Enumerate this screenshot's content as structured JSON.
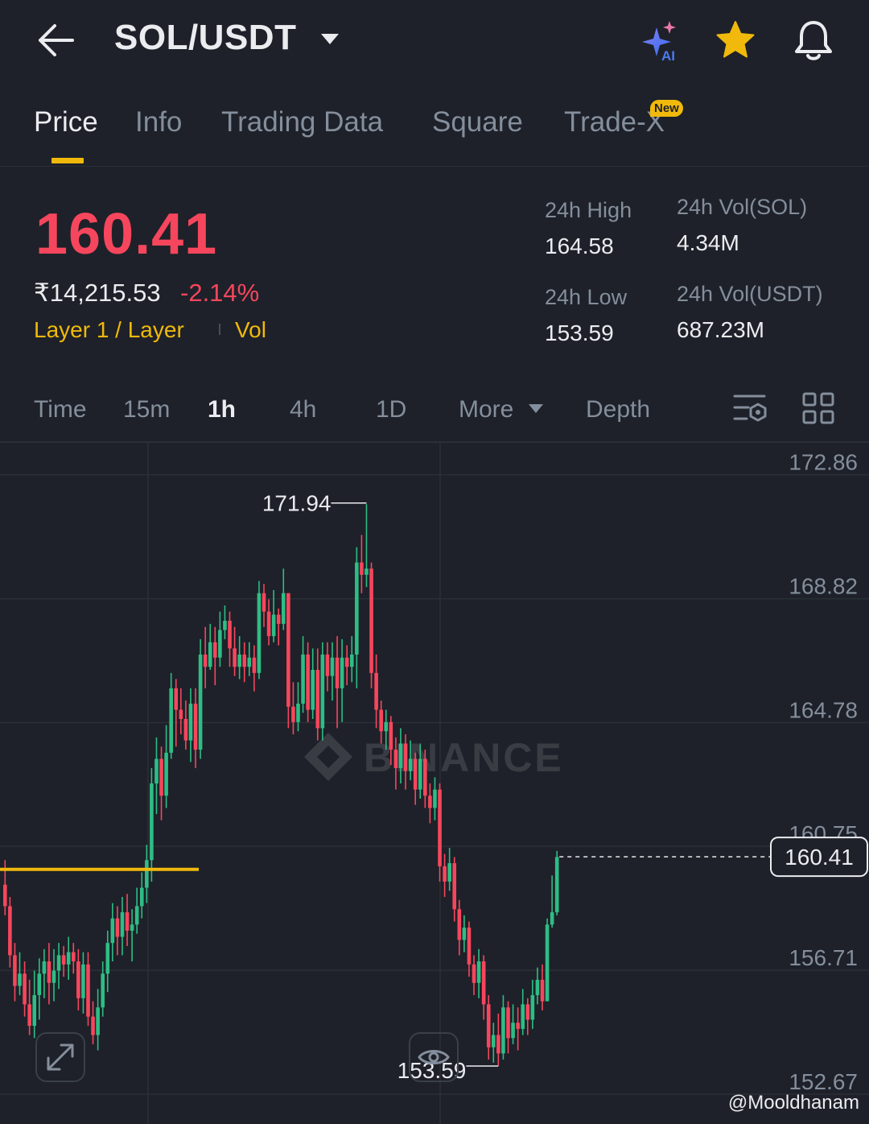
{
  "header": {
    "pair": "SOL/USDT",
    "icons": [
      "back-arrow-icon",
      "caret-down-icon",
      "ai-sparkle-icon",
      "star-icon",
      "bell-icon"
    ],
    "ai_label": "AI"
  },
  "tabs": [
    {
      "label": "Price",
      "active": true
    },
    {
      "label": "Info"
    },
    {
      "label": "Trading Data"
    },
    {
      "label": "Square"
    },
    {
      "label": "Trade-X",
      "badge": "New"
    }
  ],
  "price": {
    "last": "160.41",
    "fiat": "₹14,215.53",
    "change": "-2.14%",
    "tag1": "Layer 1 / Layer",
    "tag2": "Vol"
  },
  "stats": {
    "high_label": "24h High",
    "high": "164.58",
    "low_label": "24h Low",
    "low": "153.59",
    "vol_sol_label": "24h Vol(SOL)",
    "vol_sol": "4.34M",
    "vol_usdt_label": "24h Vol(USDT)",
    "vol_usdt": "687.23M"
  },
  "intervals": [
    {
      "label": "Time"
    },
    {
      "label": "15m"
    },
    {
      "label": "1h",
      "active": true
    },
    {
      "label": "4h"
    },
    {
      "label": "1D"
    },
    {
      "label": "More"
    },
    {
      "label": "Depth"
    }
  ],
  "colors": {
    "up": "#2ebd85",
    "down": "#f6465d",
    "accent": "#f0b90b",
    "bg": "#1e2129",
    "grid": "#2b2f36"
  },
  "chart_data": {
    "type": "candlestick",
    "y_ticks": [
      172.86,
      168.82,
      164.78,
      160.75,
      156.71,
      152.67
    ],
    "ylim": [
      151.7,
      173.9
    ],
    "grid": true,
    "last_price": 160.41,
    "high_marker": 171.94,
    "low_marker": 153.59,
    "reference_line": 160.0,
    "watermark": "BINANCE",
    "candles": [
      [
        159.5,
        158.8,
        160.3,
        158.5
      ],
      [
        158.8,
        157.2,
        159.1,
        156.8
      ],
      [
        157.2,
        156.2,
        157.6,
        155.7
      ],
      [
        156.2,
        156.6,
        157.3,
        155.9
      ],
      [
        156.6,
        155.6,
        157.0,
        155.2
      ],
      [
        155.6,
        154.9,
        156.4,
        154.6
      ],
      [
        154.9,
        155.9,
        156.7,
        154.5
      ],
      [
        155.9,
        156.6,
        157.1,
        155.1
      ],
      [
        156.6,
        157.0,
        157.4,
        155.8
      ],
      [
        157.0,
        156.3,
        157.6,
        155.6
      ],
      [
        156.3,
        156.7,
        157.4,
        155.7
      ],
      [
        156.7,
        157.2,
        157.6,
        156.1
      ],
      [
        157.2,
        156.9,
        157.5,
        156.5
      ],
      [
        156.9,
        157.3,
        157.8,
        156.4
      ],
      [
        157.3,
        157.0,
        157.6,
        156.6
      ],
      [
        157.0,
        155.8,
        157.4,
        155.4
      ],
      [
        155.8,
        156.9,
        157.3,
        155.3
      ],
      [
        156.9,
        155.2,
        157.3,
        154.9
      ],
      [
        155.2,
        154.6,
        155.7,
        154.3
      ],
      [
        154.6,
        155.5,
        156.1,
        154.1
      ],
      [
        155.5,
        156.6,
        157.0,
        155.2
      ],
      [
        156.6,
        157.6,
        158.0,
        156.0
      ],
      [
        157.6,
        158.4,
        158.9,
        157.0
      ],
      [
        158.4,
        157.8,
        158.8,
        157.2
      ],
      [
        157.8,
        158.6,
        159.1,
        157.2
      ],
      [
        158.6,
        158.0,
        159.2,
        157.5
      ],
      [
        158.0,
        158.2,
        158.7,
        157.0
      ],
      [
        158.2,
        158.8,
        159.4,
        157.9
      ],
      [
        158.8,
        159.4,
        159.9,
        158.4
      ],
      [
        159.4,
        160.3,
        160.8,
        158.9
      ],
      [
        160.3,
        162.8,
        163.3,
        159.6
      ],
      [
        162.8,
        163.6,
        164.3,
        161.8
      ],
      [
        163.6,
        162.4,
        164.0,
        161.6
      ],
      [
        162.4,
        163.8,
        164.7,
        162.0
      ],
      [
        163.8,
        165.9,
        166.4,
        163.6
      ],
      [
        165.9,
        165.2,
        166.2,
        164.0
      ],
      [
        165.2,
        164.9,
        165.9,
        164.4
      ],
      [
        164.9,
        164.2,
        165.5,
        163.9
      ],
      [
        164.2,
        165.4,
        165.9,
        163.5
      ],
      [
        165.4,
        163.9,
        165.9,
        163.3
      ],
      [
        163.9,
        167.0,
        167.5,
        163.6
      ],
      [
        167.0,
        166.6,
        167.9,
        165.9
      ],
      [
        166.6,
        167.4,
        168.0,
        166.5
      ],
      [
        167.4,
        166.9,
        167.9,
        166.0
      ],
      [
        166.9,
        167.8,
        168.4,
        166.6
      ],
      [
        167.8,
        168.1,
        168.6,
        167.5
      ],
      [
        168.1,
        167.2,
        168.4,
        166.6
      ],
      [
        167.2,
        166.6,
        167.9,
        166.3
      ],
      [
        166.6,
        167.0,
        167.6,
        166.2
      ],
      [
        167.0,
        166.6,
        167.4,
        166.1
      ],
      [
        166.6,
        166.9,
        167.4,
        166.3
      ],
      [
        166.9,
        166.4,
        167.3,
        165.8
      ],
      [
        166.4,
        169.0,
        169.4,
        166.2
      ],
      [
        169.0,
        168.4,
        169.3,
        167.9
      ],
      [
        168.4,
        167.6,
        168.8,
        167.3
      ],
      [
        167.6,
        168.3,
        169.1,
        167.4
      ],
      [
        168.3,
        168.0,
        168.5,
        167.3
      ],
      [
        168.0,
        169.0,
        169.8,
        167.8
      ],
      [
        169.0,
        165.3,
        169.0,
        164.6
      ],
      [
        165.3,
        164.8,
        166.1,
        164.4
      ],
      [
        164.8,
        165.4,
        166.1,
        164.5
      ],
      [
        165.4,
        167.0,
        167.6,
        165.1
      ],
      [
        167.0,
        165.2,
        167.4,
        164.8
      ],
      [
        165.2,
        166.5,
        167.2,
        164.9
      ],
      [
        166.5,
        164.6,
        167.2,
        164.2
      ],
      [
        164.6,
        167.0,
        167.4,
        164.2
      ],
      [
        167.0,
        166.3,
        167.4,
        165.8
      ],
      [
        166.3,
        166.9,
        167.4,
        165.5
      ],
      [
        166.9,
        165.9,
        167.6,
        164.6
      ],
      [
        165.9,
        166.9,
        167.5,
        164.8
      ],
      [
        166.9,
        166.6,
        167.3,
        166.0
      ],
      [
        166.6,
        167.0,
        167.6,
        166.1
      ],
      [
        167.0,
        170.0,
        170.5,
        165.9
      ],
      [
        170.0,
        169.6,
        170.9,
        169.0
      ],
      [
        169.6,
        169.8,
        171.9,
        169.2
      ],
      [
        169.8,
        166.4,
        170.0,
        165.9
      ],
      [
        166.4,
        165.2,
        167.0,
        164.6
      ],
      [
        165.2,
        164.5,
        165.5,
        164.1
      ],
      [
        164.5,
        164.8,
        165.2,
        163.9
      ],
      [
        164.8,
        163.9,
        165.0,
        163.4
      ],
      [
        163.9,
        163.3,
        164.3,
        162.6
      ],
      [
        163.3,
        164.1,
        164.6,
        162.8
      ],
      [
        164.1,
        163.2,
        164.4,
        162.6
      ],
      [
        163.2,
        163.6,
        164.2,
        162.9
      ],
      [
        163.6,
        162.6,
        163.8,
        162.1
      ],
      [
        162.6,
        163.6,
        164.1,
        162.3
      ],
      [
        163.6,
        162.4,
        163.9,
        162.0
      ],
      [
        162.4,
        162.0,
        162.8,
        161.5
      ],
      [
        162.0,
        162.6,
        163.0,
        161.6
      ],
      [
        162.6,
        160.1,
        162.8,
        159.6
      ],
      [
        160.1,
        159.6,
        160.5,
        159.1
      ],
      [
        159.6,
        160.2,
        160.7,
        159.3
      ],
      [
        160.2,
        158.7,
        160.4,
        158.3
      ],
      [
        158.7,
        157.7,
        159.0,
        157.2
      ],
      [
        157.7,
        158.1,
        158.5,
        157.3
      ],
      [
        158.1,
        156.9,
        158.3,
        156.5
      ],
      [
        156.9,
        156.3,
        157.2,
        155.9
      ],
      [
        156.3,
        157.0,
        157.4,
        155.8
      ],
      [
        157.0,
        155.6,
        157.2,
        155.1
      ],
      [
        155.6,
        154.2,
        155.9,
        153.8
      ],
      [
        154.2,
        154.6,
        155.0,
        153.7
      ],
      [
        154.6,
        154.0,
        155.3,
        153.6
      ],
      [
        154.0,
        155.5,
        155.9,
        153.8
      ],
      [
        155.5,
        154.5,
        155.7,
        154.0
      ],
      [
        154.5,
        155.0,
        155.6,
        154.3
      ],
      [
        155.0,
        154.8,
        155.5,
        154.1
      ],
      [
        154.8,
        155.6,
        156.1,
        154.6
      ],
      [
        155.6,
        155.1,
        155.8,
        154.6
      ],
      [
        155.1,
        155.9,
        156.4,
        154.8
      ],
      [
        155.9,
        156.4,
        156.8,
        155.6
      ],
      [
        156.4,
        155.7,
        156.9,
        155.4
      ],
      [
        155.7,
        158.2,
        158.4,
        155.7
      ],
      [
        158.2,
        158.6,
        159.8,
        158.1
      ],
      [
        158.6,
        160.4,
        160.6,
        158.5
      ]
    ]
  },
  "credit": "@Mooldhanam"
}
